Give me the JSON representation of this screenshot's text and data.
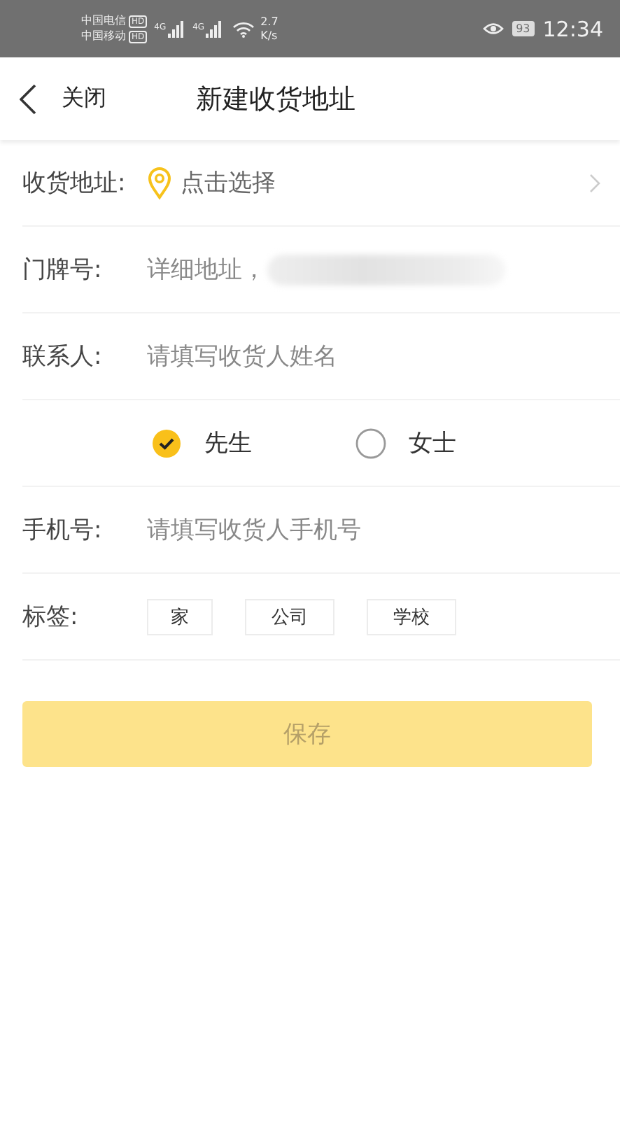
{
  "status_bar": {
    "carriers": [
      {
        "name": "中国电信",
        "badge": "HD"
      },
      {
        "name": "中国移动",
        "badge": "HD"
      }
    ],
    "signals": [
      "4G",
      "4G"
    ],
    "speed": {
      "value": "2.7",
      "unit": "K/s"
    },
    "battery": "93",
    "time": "12:34"
  },
  "header": {
    "back": "关闭",
    "title": "新建收货地址"
  },
  "form": [
    {
      "kind": "picker",
      "label": "收货地址:",
      "value": "点击选择"
    },
    {
      "kind": "input",
      "label": "门牌号:",
      "placeholder": "详细地址，",
      "redacted": true
    },
    {
      "kind": "input",
      "label": "联系人:",
      "placeholder": "请填写收货人姓名",
      "redacted": false
    },
    {
      "kind": "gender",
      "options": [
        {
          "label": "先生",
          "selected": true
        },
        {
          "label": "女士",
          "selected": false
        }
      ]
    },
    {
      "kind": "input",
      "label": "手机号:",
      "placeholder": "请填写收货人手机号",
      "redacted": false
    },
    {
      "kind": "tags",
      "label": "标签:",
      "tags": [
        "家",
        "公司",
        "学校"
      ]
    }
  ],
  "save_button": {
    "label": "保存",
    "disabled": true
  }
}
